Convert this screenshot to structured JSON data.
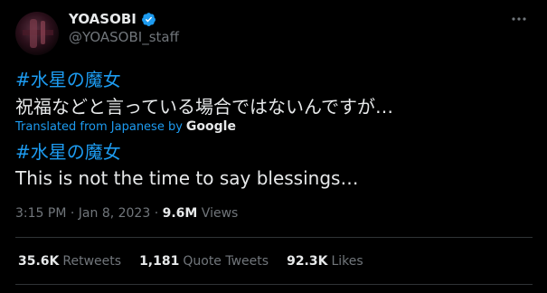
{
  "author": {
    "name": "YOASOBI",
    "handle": "@YOASOBI_staff"
  },
  "tweet": {
    "hashtag": "#水星の魔女",
    "text_original": "祝福などと言っている場合ではないんですが…",
    "translated_label": "Translated from Japanese by",
    "translator": "Google",
    "hashtag_translated": "#水星の魔女",
    "text_translated": "This is not the time to say blessings…",
    "time": "3:15 PM",
    "date": "Jan 8, 2023",
    "views_count": "9.6M",
    "views_label": "Views"
  },
  "stats": {
    "retweets_count": "35.6K",
    "retweets_label": "Retweets",
    "quotes_count": "1,181",
    "quotes_label": "Quote Tweets",
    "likes_count": "92.3K",
    "likes_label": "Likes"
  },
  "colors": {
    "background": "#000000",
    "text": "#e7e9ea",
    "secondary": "#71767b",
    "accent": "#1d9bf0"
  }
}
